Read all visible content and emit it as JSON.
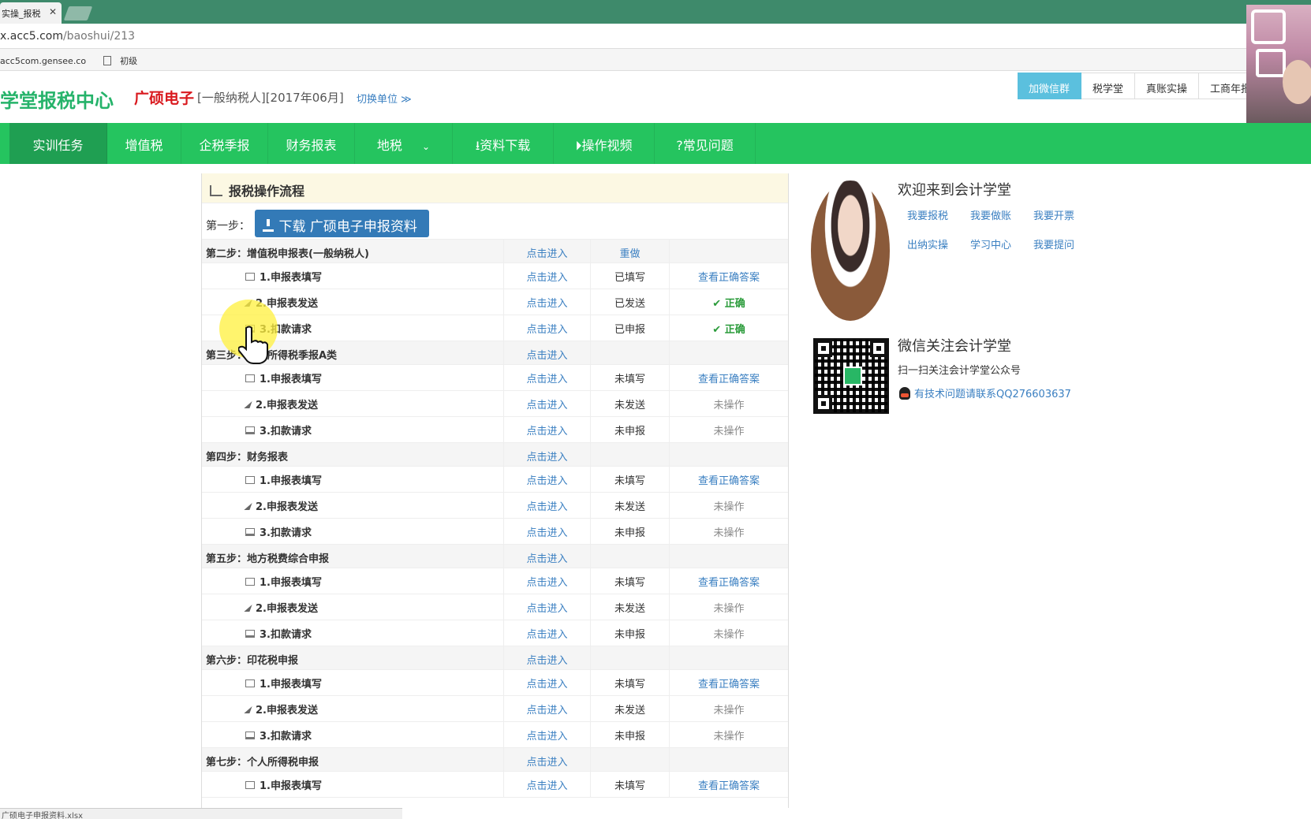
{
  "browser": {
    "tab_title": "实操_报税",
    "url_prefix": "x.acc5.com",
    "url_path": "/baoshui/213",
    "bookmarks": [
      "acc5com.gensee.co",
      "初级"
    ]
  },
  "header": {
    "logo": "学堂报税中心",
    "company": "广硕电子",
    "company_type": "[一般纳税人][2017年06月]",
    "switch_unit": "切换单位 ≫",
    "top_links": [
      "加微信群",
      "税学堂",
      "真账实操",
      "工商年报"
    ]
  },
  "nav": {
    "items": [
      "实训任务",
      "增值税",
      "企税季报",
      "财务报表",
      "地税",
      "资料下载",
      "操作视频",
      "常见问题"
    ]
  },
  "panel": {
    "title": "报税操作流程",
    "step1_label": "第一步：",
    "download_button": "下载 广硕电子申报资料",
    "rows": [
      {
        "kind": "step",
        "label": "第二步：增值税申报表(一般纳税人)",
        "action": "点击进入",
        "status": "重做",
        "status_link": true,
        "result": ""
      },
      {
        "kind": "sub",
        "icon": "edit",
        "label": "1.申报表填写",
        "action": "点击进入",
        "status": "已填写",
        "result": "查看正确答案",
        "result_type": "link"
      },
      {
        "kind": "sub",
        "icon": "send",
        "label": "2.申报表发送",
        "action": "点击进入",
        "status": "已发送",
        "result": "✔ 正确",
        "result_type": "ok"
      },
      {
        "kind": "sub",
        "icon": "monitor",
        "label": "3.扣款请求",
        "action": "点击进入",
        "status": "已申报",
        "result": "✔ 正确",
        "result_type": "ok"
      },
      {
        "kind": "step",
        "label": "第三步：企业所得税季报A类",
        "action": "点击进入",
        "status": "",
        "result": ""
      },
      {
        "kind": "sub",
        "icon": "edit",
        "label": "1.申报表填写",
        "action": "点击进入",
        "status": "未填写",
        "result": "查看正确答案",
        "result_type": "link"
      },
      {
        "kind": "sub",
        "icon": "send",
        "label": "2.申报表发送",
        "action": "点击进入",
        "status": "未发送",
        "result": "未操作",
        "result_type": "muted"
      },
      {
        "kind": "sub",
        "icon": "monitor",
        "label": "3.扣款请求",
        "action": "点击进入",
        "status": "未申报",
        "result": "未操作",
        "result_type": "muted"
      },
      {
        "kind": "step",
        "label": "第四步：财务报表",
        "action": "点击进入",
        "status": "",
        "result": ""
      },
      {
        "kind": "sub",
        "icon": "edit",
        "label": "1.申报表填写",
        "action": "点击进入",
        "status": "未填写",
        "result": "查看正确答案",
        "result_type": "link"
      },
      {
        "kind": "sub",
        "icon": "send",
        "label": "2.申报表发送",
        "action": "点击进入",
        "status": "未发送",
        "result": "未操作",
        "result_type": "muted"
      },
      {
        "kind": "sub",
        "icon": "monitor",
        "label": "3.扣款请求",
        "action": "点击进入",
        "status": "未申报",
        "result": "未操作",
        "result_type": "muted"
      },
      {
        "kind": "step",
        "label": "第五步：地方税费综合申报",
        "action": "点击进入",
        "status": "",
        "result": ""
      },
      {
        "kind": "sub",
        "icon": "edit",
        "label": "1.申报表填写",
        "action": "点击进入",
        "status": "未填写",
        "result": "查看正确答案",
        "result_type": "link"
      },
      {
        "kind": "sub",
        "icon": "send",
        "label": "2.申报表发送",
        "action": "点击进入",
        "status": "未发送",
        "result": "未操作",
        "result_type": "muted"
      },
      {
        "kind": "sub",
        "icon": "monitor",
        "label": "3.扣款请求",
        "action": "点击进入",
        "status": "未申报",
        "result": "未操作",
        "result_type": "muted"
      },
      {
        "kind": "step",
        "label": "第六步：印花税申报",
        "action": "点击进入",
        "status": "",
        "result": ""
      },
      {
        "kind": "sub",
        "icon": "edit",
        "label": "1.申报表填写",
        "action": "点击进入",
        "status": "未填写",
        "result": "查看正确答案",
        "result_type": "link"
      },
      {
        "kind": "sub",
        "icon": "send",
        "label": "2.申报表发送",
        "action": "点击进入",
        "status": "未发送",
        "result": "未操作",
        "result_type": "muted"
      },
      {
        "kind": "sub",
        "icon": "monitor",
        "label": "3.扣款请求",
        "action": "点击进入",
        "status": "未申报",
        "result": "未操作",
        "result_type": "muted"
      },
      {
        "kind": "step",
        "label": "第七步：个人所得税申报",
        "action": "点击进入",
        "status": "",
        "result": ""
      },
      {
        "kind": "sub",
        "icon": "edit",
        "label": "1.申报表填写",
        "action": "点击进入",
        "status": "未填写",
        "result": "查看正确答案",
        "result_type": "link"
      }
    ]
  },
  "sidebar": {
    "welcome": "欢迎来到会计学堂",
    "quick_links": [
      "我要报税",
      "我要做账",
      "我要开票",
      "出纳实操",
      "学习中心",
      "我要提问"
    ],
    "wechat_title": "微信关注会计学堂",
    "wechat_sub": "扫一扫关注会计学堂公众号",
    "qq_text": "有技术问题请联系QQ276603637"
  },
  "status_bar": "广硕电子申报资料.xlsx",
  "colors": {
    "nav_green": "#25c45f",
    "nav_active": "#1f9f52",
    "logo_green": "#25b36a",
    "company_red": "#d9191e",
    "link_blue": "#3a7fc1",
    "button_blue": "#337ab7",
    "ok_green": "#2a9b3a",
    "panel_head_bg": "#fcf8e3"
  }
}
